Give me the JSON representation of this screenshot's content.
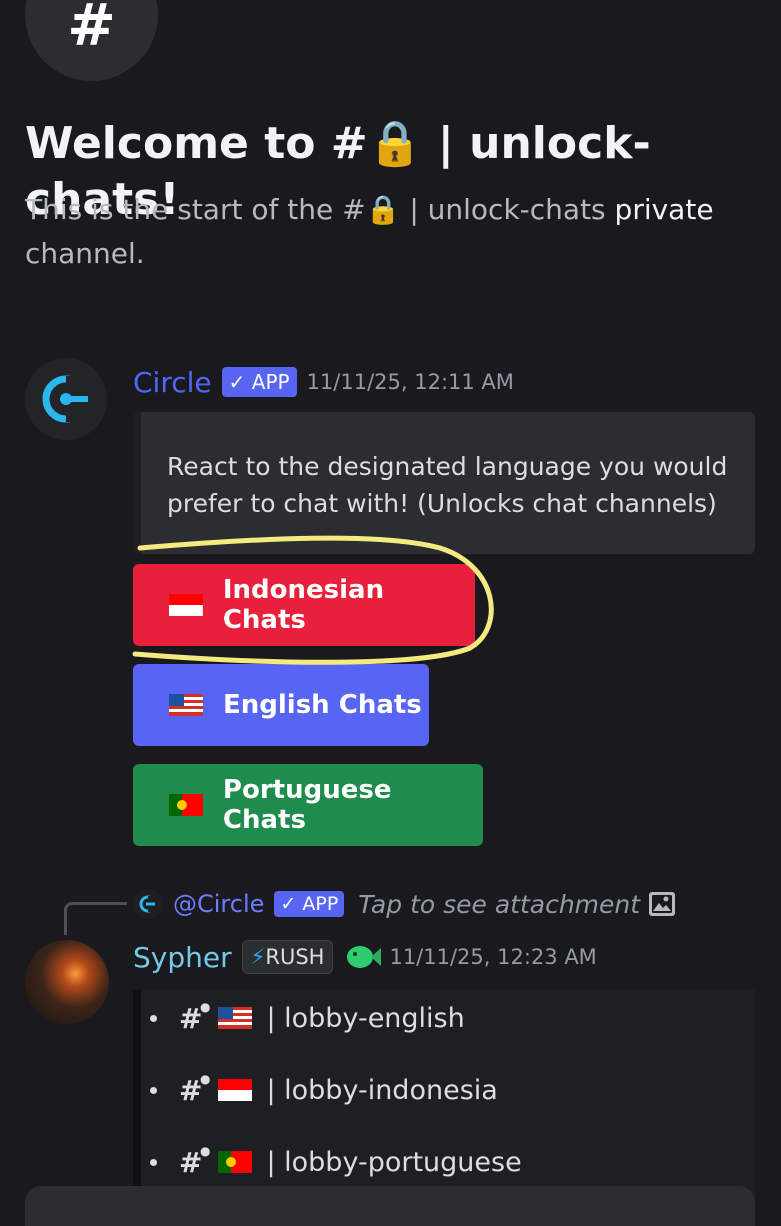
{
  "channel_header": {
    "icon_glyph": "#",
    "title": "Welcome to #🔒 | unlock-chats!",
    "intro_prefix": "This is the start of the #🔒 | unlock-chats",
    "intro_private": "private",
    "intro_suffix": "channel."
  },
  "message1": {
    "author": "Circle",
    "tag": "✓ APP",
    "timestamp": "11/11/25, 12:11 AM",
    "embed_text": "React to the designated language you would prefer to chat with! (Unlocks chat channels)",
    "buttons": [
      {
        "label": "Indonesian Chats",
        "flag": "indonesia-flag",
        "color": "#e8203b"
      },
      {
        "label": "English Chats",
        "flag": "usa-flag",
        "color": "#5865f2"
      },
      {
        "label": "Portuguese Chats",
        "flag": "portugal-flag",
        "color": "#1f8b4c"
      }
    ]
  },
  "message2": {
    "reply_mention": "@Circle",
    "reply_tag": "✓ APP",
    "reply_text": "Tap to see attachment",
    "author": "Sypher",
    "tag_bolt": "⚡",
    "tag": "RUSH",
    "timestamp": "11/11/25, 12:23 AM",
    "channels": [
      {
        "name": "| lobby-english",
        "flag": "usa-flag"
      },
      {
        "name": "| lobby-indonesia",
        "flag": "indonesia-flag"
      },
      {
        "name": "| lobby-portuguese",
        "flag": "portugal-flag"
      }
    ]
  },
  "colors": {
    "background": "#1a1a1e",
    "brand": "#5865f2",
    "danger": "#e8203b",
    "success": "#1f8b4c",
    "highlight": "#f3ea80"
  }
}
